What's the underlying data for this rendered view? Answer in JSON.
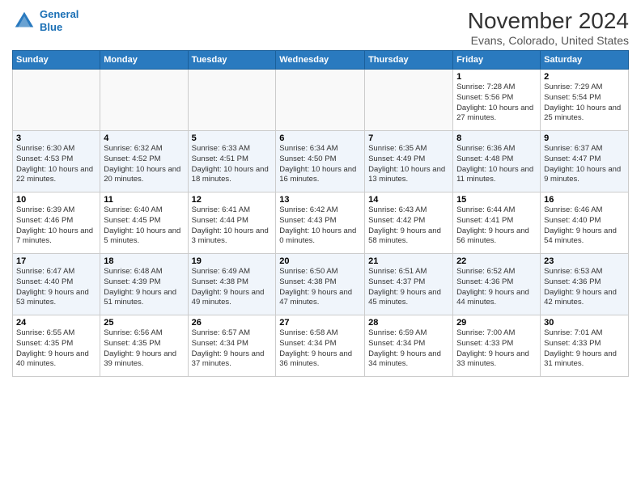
{
  "header": {
    "logo_line1": "General",
    "logo_line2": "Blue",
    "title": "November 2024",
    "subtitle": "Evans, Colorado, United States"
  },
  "weekdays": [
    "Sunday",
    "Monday",
    "Tuesday",
    "Wednesday",
    "Thursday",
    "Friday",
    "Saturday"
  ],
  "weeks": [
    [
      {
        "day": "",
        "info": ""
      },
      {
        "day": "",
        "info": ""
      },
      {
        "day": "",
        "info": ""
      },
      {
        "day": "",
        "info": ""
      },
      {
        "day": "",
        "info": ""
      },
      {
        "day": "1",
        "info": "Sunrise: 7:28 AM\nSunset: 5:56 PM\nDaylight: 10 hours and 27 minutes."
      },
      {
        "day": "2",
        "info": "Sunrise: 7:29 AM\nSunset: 5:54 PM\nDaylight: 10 hours and 25 minutes."
      }
    ],
    [
      {
        "day": "3",
        "info": "Sunrise: 6:30 AM\nSunset: 4:53 PM\nDaylight: 10 hours and 22 minutes."
      },
      {
        "day": "4",
        "info": "Sunrise: 6:32 AM\nSunset: 4:52 PM\nDaylight: 10 hours and 20 minutes."
      },
      {
        "day": "5",
        "info": "Sunrise: 6:33 AM\nSunset: 4:51 PM\nDaylight: 10 hours and 18 minutes."
      },
      {
        "day": "6",
        "info": "Sunrise: 6:34 AM\nSunset: 4:50 PM\nDaylight: 10 hours and 16 minutes."
      },
      {
        "day": "7",
        "info": "Sunrise: 6:35 AM\nSunset: 4:49 PM\nDaylight: 10 hours and 13 minutes."
      },
      {
        "day": "8",
        "info": "Sunrise: 6:36 AM\nSunset: 4:48 PM\nDaylight: 10 hours and 11 minutes."
      },
      {
        "day": "9",
        "info": "Sunrise: 6:37 AM\nSunset: 4:47 PM\nDaylight: 10 hours and 9 minutes."
      }
    ],
    [
      {
        "day": "10",
        "info": "Sunrise: 6:39 AM\nSunset: 4:46 PM\nDaylight: 10 hours and 7 minutes."
      },
      {
        "day": "11",
        "info": "Sunrise: 6:40 AM\nSunset: 4:45 PM\nDaylight: 10 hours and 5 minutes."
      },
      {
        "day": "12",
        "info": "Sunrise: 6:41 AM\nSunset: 4:44 PM\nDaylight: 10 hours and 3 minutes."
      },
      {
        "day": "13",
        "info": "Sunrise: 6:42 AM\nSunset: 4:43 PM\nDaylight: 10 hours and 0 minutes."
      },
      {
        "day": "14",
        "info": "Sunrise: 6:43 AM\nSunset: 4:42 PM\nDaylight: 9 hours and 58 minutes."
      },
      {
        "day": "15",
        "info": "Sunrise: 6:44 AM\nSunset: 4:41 PM\nDaylight: 9 hours and 56 minutes."
      },
      {
        "day": "16",
        "info": "Sunrise: 6:46 AM\nSunset: 4:40 PM\nDaylight: 9 hours and 54 minutes."
      }
    ],
    [
      {
        "day": "17",
        "info": "Sunrise: 6:47 AM\nSunset: 4:40 PM\nDaylight: 9 hours and 53 minutes."
      },
      {
        "day": "18",
        "info": "Sunrise: 6:48 AM\nSunset: 4:39 PM\nDaylight: 9 hours and 51 minutes."
      },
      {
        "day": "19",
        "info": "Sunrise: 6:49 AM\nSunset: 4:38 PM\nDaylight: 9 hours and 49 minutes."
      },
      {
        "day": "20",
        "info": "Sunrise: 6:50 AM\nSunset: 4:38 PM\nDaylight: 9 hours and 47 minutes."
      },
      {
        "day": "21",
        "info": "Sunrise: 6:51 AM\nSunset: 4:37 PM\nDaylight: 9 hours and 45 minutes."
      },
      {
        "day": "22",
        "info": "Sunrise: 6:52 AM\nSunset: 4:36 PM\nDaylight: 9 hours and 44 minutes."
      },
      {
        "day": "23",
        "info": "Sunrise: 6:53 AM\nSunset: 4:36 PM\nDaylight: 9 hours and 42 minutes."
      }
    ],
    [
      {
        "day": "24",
        "info": "Sunrise: 6:55 AM\nSunset: 4:35 PM\nDaylight: 9 hours and 40 minutes."
      },
      {
        "day": "25",
        "info": "Sunrise: 6:56 AM\nSunset: 4:35 PM\nDaylight: 9 hours and 39 minutes."
      },
      {
        "day": "26",
        "info": "Sunrise: 6:57 AM\nSunset: 4:34 PM\nDaylight: 9 hours and 37 minutes."
      },
      {
        "day": "27",
        "info": "Sunrise: 6:58 AM\nSunset: 4:34 PM\nDaylight: 9 hours and 36 minutes."
      },
      {
        "day": "28",
        "info": "Sunrise: 6:59 AM\nSunset: 4:34 PM\nDaylight: 9 hours and 34 minutes."
      },
      {
        "day": "29",
        "info": "Sunrise: 7:00 AM\nSunset: 4:33 PM\nDaylight: 9 hours and 33 minutes."
      },
      {
        "day": "30",
        "info": "Sunrise: 7:01 AM\nSunset: 4:33 PM\nDaylight: 9 hours and 31 minutes."
      }
    ]
  ]
}
